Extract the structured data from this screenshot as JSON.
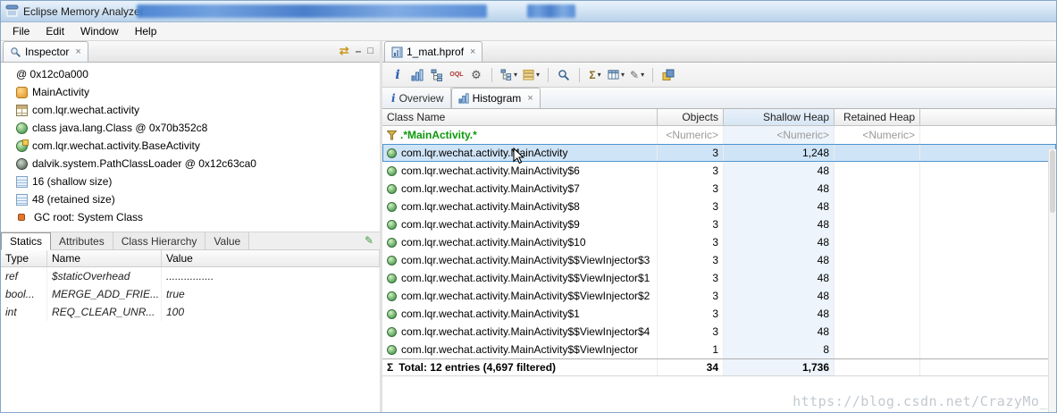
{
  "window": {
    "title": "Eclipse Memory Analyzer",
    "menu_items": [
      "File",
      "Edit",
      "Window",
      "Help"
    ]
  },
  "inspector": {
    "tab_label": "Inspector",
    "toolbar_icons": [
      "sync-icon",
      "minimize-icon",
      "maximize-icon"
    ],
    "tree": [
      {
        "icon": "object-address",
        "label": "@ 0x12c0a000"
      },
      {
        "icon": "instance-icon",
        "label": "MainActivity"
      },
      {
        "icon": "package-icon",
        "label": "com.lqr.wechat.activity"
      },
      {
        "icon": "class-icon",
        "label": "class java.lang.Class @ 0x70b352c8"
      },
      {
        "icon": "class-icon",
        "label": "com.lqr.wechat.activity.BaseActivity"
      },
      {
        "icon": "classloader-icon",
        "label": "dalvik.system.PathClassLoader @ 0x12c63ca0"
      },
      {
        "icon": "shallow-size-icon",
        "label": "16 (shallow size)"
      },
      {
        "icon": "retained-size-icon",
        "label": "48 (retained size)"
      },
      {
        "icon": "gc-root-icon",
        "label": "GC root: System Class"
      }
    ],
    "detail_tabs": [
      "Statics",
      "Attributes",
      "Class Hierarchy",
      "Value"
    ],
    "active_detail_tab": "Statics",
    "statics_table": {
      "columns": [
        "Type",
        "Name",
        "Value"
      ],
      "rows": [
        {
          "type": "ref",
          "name": "$staticOverhead",
          "value": "................"
        },
        {
          "type": "bool...",
          "name": "MERGE_ADD_FRIE...",
          "value": "true"
        },
        {
          "type": "int",
          "name": "REQ_CLEAR_UNR...",
          "value": "100"
        }
      ]
    }
  },
  "editor": {
    "tab_label": "1_mat.hprof",
    "toolbar_icons": [
      "info-icon",
      "histogram-icon",
      "dominator-tree-icon",
      "oql-icon",
      "settings-gear-icon",
      "tree-dropdown-icon",
      "grouping-dropdown-icon",
      "search-icon",
      "calculate-retained-sizes-icon",
      "customize-columns-icon",
      "export-icon",
      "compare-icon"
    ],
    "subtabs": {
      "overview": "Overview",
      "histogram": "Histogram"
    },
    "histogram": {
      "columns": {
        "class_name": "Class Name",
        "objects": "Objects",
        "shallow_heap": "Shallow Heap",
        "retained_heap": "Retained Heap"
      },
      "filter": {
        "pattern": ".*MainActivity.*",
        "objects": "<Numeric>",
        "shallow_heap": "<Numeric>",
        "retained_heap": "<Numeric>"
      },
      "rows": [
        {
          "class_name": "com.lqr.wechat.activity.MainActivity",
          "objects": "3",
          "shallow_heap": "1,248",
          "retained_heap": "",
          "selected": true
        },
        {
          "class_name": "com.lqr.wechat.activity.MainActivity$6",
          "objects": "3",
          "shallow_heap": "48",
          "retained_heap": ""
        },
        {
          "class_name": "com.lqr.wechat.activity.MainActivity$7",
          "objects": "3",
          "shallow_heap": "48",
          "retained_heap": ""
        },
        {
          "class_name": "com.lqr.wechat.activity.MainActivity$8",
          "objects": "3",
          "shallow_heap": "48",
          "retained_heap": ""
        },
        {
          "class_name": "com.lqr.wechat.activity.MainActivity$9",
          "objects": "3",
          "shallow_heap": "48",
          "retained_heap": ""
        },
        {
          "class_name": "com.lqr.wechat.activity.MainActivity$10",
          "objects": "3",
          "shallow_heap": "48",
          "retained_heap": ""
        },
        {
          "class_name": "com.lqr.wechat.activity.MainActivity$$ViewInjector$3",
          "objects": "3",
          "shallow_heap": "48",
          "retained_heap": ""
        },
        {
          "class_name": "com.lqr.wechat.activity.MainActivity$$ViewInjector$1",
          "objects": "3",
          "shallow_heap": "48",
          "retained_heap": ""
        },
        {
          "class_name": "com.lqr.wechat.activity.MainActivity$$ViewInjector$2",
          "objects": "3",
          "shallow_heap": "48",
          "retained_heap": ""
        },
        {
          "class_name": "com.lqr.wechat.activity.MainActivity$1",
          "objects": "3",
          "shallow_heap": "48",
          "retained_heap": ""
        },
        {
          "class_name": "com.lqr.wechat.activity.MainActivity$$ViewInjector$4",
          "objects": "3",
          "shallow_heap": "48",
          "retained_heap": ""
        },
        {
          "class_name": "com.lqr.wechat.activity.MainActivity$$ViewInjector",
          "objects": "1",
          "shallow_heap": "8",
          "retained_heap": ""
        }
      ],
      "total": {
        "sigma": "Σ",
        "label": "Total: 12 entries (4,697 filtered)",
        "objects": "34",
        "shallow_heap": "1,736",
        "retained_heap": ""
      }
    }
  },
  "watermark": "https://blog.csdn.net/CrazyMo_"
}
